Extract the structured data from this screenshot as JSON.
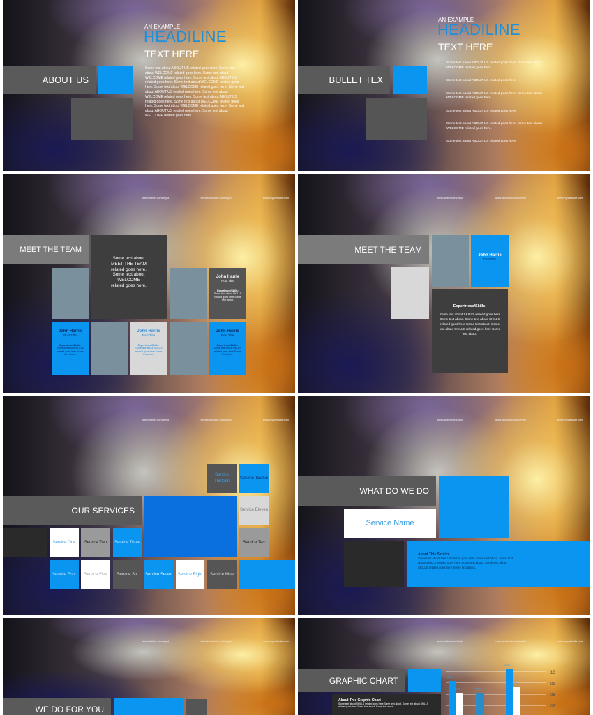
{
  "links": [
    "www.twitter.com/myid",
    "www.facebook.com/myid",
    "www.mywebsite.com"
  ],
  "colors": {
    "accent_blue": "#0a96f0",
    "headline_blue": "#1f8fd8",
    "bar_gray": "#5a5a5a"
  },
  "slide1": {
    "title": "ABOUT US",
    "eyebrow": "AN EXAMPLE",
    "headline": "HEADILINE",
    "subhead": "TEXT HERE",
    "body": "Some text about ABOUT US related goes here. Some text about WELCOME related goes here. Some text about WELCOME related goes here. Some text about ABOUT US related goes here. Some text about WELCOME related goes here. Some text about WELCOME related goes here. Some text about ABOUT US related goes here. Some text about WELCOME related goes here. Some text about ABOUT US related goes here. Some text about WELCOME related goes here. Some text about WELCOME related goes here. Some text about ABOUT US related goes here. Some text about WELCOME related goes here."
  },
  "slide2": {
    "title": "BULLET TEX",
    "eyebrow": "AN EXAMPLE",
    "headline": "HEADILINE",
    "subhead": "TEXT HERE",
    "bullet_icon": "chevron-right",
    "bullets": [
      "Some text about ABOUT US related goes here. Some text about WELCOME related goes here.",
      "Some text about ABOUT US related goes here.",
      "Some text about ABOUT US related goes here. Some text about WELCOME related goes here.",
      "Some text about ABOUT US related goes here.",
      "Some text about ABOUT US related goes here. Some text about WELCOME related goes here.",
      "Some text about ABOUT US related goes here."
    ]
  },
  "slide3": {
    "title": "MEET THE TEAM",
    "intro": "Some text about MEET THE TEAM related goes here. Some text about WELCOME related goes here.",
    "member": {
      "name": "John Harrie",
      "post": "Post Title",
      "skills_label": "Experience/Skills:",
      "skills_text": "Some text about SKILLS related goes here Some text about."
    }
  },
  "slide4": {
    "title": "MEET THE TEAM",
    "name": "John Harrie",
    "post": "Post Title",
    "skills_label": "Expertness/Skills:",
    "skills_text": "Some text about SKILLS related goes here Some text about. Some text about SKILLS related goes here Some text about. Some text about SKILLS related goes here Some text about."
  },
  "slide5": {
    "title": "OUR SERVICES",
    "services": [
      "Service One",
      "Service Two",
      "Service Three",
      "Service Four",
      "Service Five",
      "Service Six",
      "Service Seven",
      "Service Eight",
      "Service Nine",
      "Service Ten",
      "Service Eleven",
      "Service Twelve",
      "Service Thirteen"
    ]
  },
  "slide6": {
    "title": "WHAT DO WE DO",
    "service_name": "Service Name",
    "about_title": "About This Service",
    "about_text": "Some text about SKILLS related goes here Some text about. Some text about SKILLS related goes here Some text about. Some text about SKILLS related goes here Some text about."
  },
  "slide7": {
    "title": "WE DO FOR YOU"
  },
  "slide8": {
    "title": "GRAPHIC CHART",
    "about_title": "About This Graphic Chart",
    "about_text": "Some text about SKILLS related goes here Some text about. Some text about SKILLS related goes here Some text about. Some text about."
  },
  "chart_data": {
    "type": "bar",
    "bars": [
      {
        "value": 80,
        "label": "80%",
        "color": "#0a96f0"
      },
      {
        "value": 60,
        "label": "60%",
        "color": "#ffffff"
      },
      {
        "value": 60,
        "label": "60%",
        "color": "#2a8cc8"
      },
      {
        "value": 100,
        "label": "100%",
        "color": "#0a96f0"
      },
      {
        "value": 70,
        "label": "70%",
        "color": "#ffffff"
      }
    ],
    "y_ticks": [
      "10",
      "09",
      "08",
      "07"
    ],
    "grid": true
  }
}
